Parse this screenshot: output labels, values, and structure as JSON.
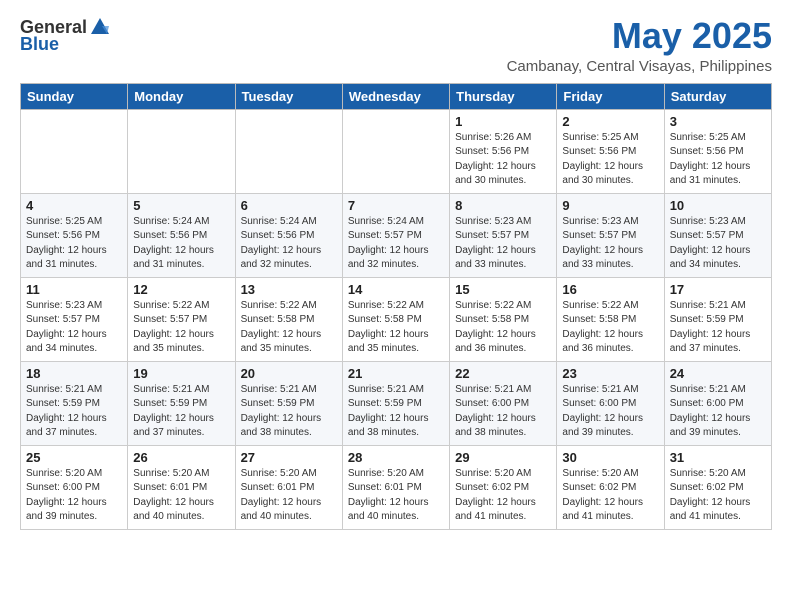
{
  "header": {
    "logo_general": "General",
    "logo_blue": "Blue",
    "month_title": "May 2025",
    "location": "Cambanay, Central Visayas, Philippines"
  },
  "weekdays": [
    "Sunday",
    "Monday",
    "Tuesday",
    "Wednesday",
    "Thursday",
    "Friday",
    "Saturday"
  ],
  "weeks": [
    [
      {
        "day": "",
        "info": ""
      },
      {
        "day": "",
        "info": ""
      },
      {
        "day": "",
        "info": ""
      },
      {
        "day": "",
        "info": ""
      },
      {
        "day": "1",
        "info": "Sunrise: 5:26 AM\nSunset: 5:56 PM\nDaylight: 12 hours\nand 30 minutes."
      },
      {
        "day": "2",
        "info": "Sunrise: 5:25 AM\nSunset: 5:56 PM\nDaylight: 12 hours\nand 30 minutes."
      },
      {
        "day": "3",
        "info": "Sunrise: 5:25 AM\nSunset: 5:56 PM\nDaylight: 12 hours\nand 31 minutes."
      }
    ],
    [
      {
        "day": "4",
        "info": "Sunrise: 5:25 AM\nSunset: 5:56 PM\nDaylight: 12 hours\nand 31 minutes."
      },
      {
        "day": "5",
        "info": "Sunrise: 5:24 AM\nSunset: 5:56 PM\nDaylight: 12 hours\nand 31 minutes."
      },
      {
        "day": "6",
        "info": "Sunrise: 5:24 AM\nSunset: 5:56 PM\nDaylight: 12 hours\nand 32 minutes."
      },
      {
        "day": "7",
        "info": "Sunrise: 5:24 AM\nSunset: 5:57 PM\nDaylight: 12 hours\nand 32 minutes."
      },
      {
        "day": "8",
        "info": "Sunrise: 5:23 AM\nSunset: 5:57 PM\nDaylight: 12 hours\nand 33 minutes."
      },
      {
        "day": "9",
        "info": "Sunrise: 5:23 AM\nSunset: 5:57 PM\nDaylight: 12 hours\nand 33 minutes."
      },
      {
        "day": "10",
        "info": "Sunrise: 5:23 AM\nSunset: 5:57 PM\nDaylight: 12 hours\nand 34 minutes."
      }
    ],
    [
      {
        "day": "11",
        "info": "Sunrise: 5:23 AM\nSunset: 5:57 PM\nDaylight: 12 hours\nand 34 minutes."
      },
      {
        "day": "12",
        "info": "Sunrise: 5:22 AM\nSunset: 5:57 PM\nDaylight: 12 hours\nand 35 minutes."
      },
      {
        "day": "13",
        "info": "Sunrise: 5:22 AM\nSunset: 5:58 PM\nDaylight: 12 hours\nand 35 minutes."
      },
      {
        "day": "14",
        "info": "Sunrise: 5:22 AM\nSunset: 5:58 PM\nDaylight: 12 hours\nand 35 minutes."
      },
      {
        "day": "15",
        "info": "Sunrise: 5:22 AM\nSunset: 5:58 PM\nDaylight: 12 hours\nand 36 minutes."
      },
      {
        "day": "16",
        "info": "Sunrise: 5:22 AM\nSunset: 5:58 PM\nDaylight: 12 hours\nand 36 minutes."
      },
      {
        "day": "17",
        "info": "Sunrise: 5:21 AM\nSunset: 5:59 PM\nDaylight: 12 hours\nand 37 minutes."
      }
    ],
    [
      {
        "day": "18",
        "info": "Sunrise: 5:21 AM\nSunset: 5:59 PM\nDaylight: 12 hours\nand 37 minutes."
      },
      {
        "day": "19",
        "info": "Sunrise: 5:21 AM\nSunset: 5:59 PM\nDaylight: 12 hours\nand 37 minutes."
      },
      {
        "day": "20",
        "info": "Sunrise: 5:21 AM\nSunset: 5:59 PM\nDaylight: 12 hours\nand 38 minutes."
      },
      {
        "day": "21",
        "info": "Sunrise: 5:21 AM\nSunset: 5:59 PM\nDaylight: 12 hours\nand 38 minutes."
      },
      {
        "day": "22",
        "info": "Sunrise: 5:21 AM\nSunset: 6:00 PM\nDaylight: 12 hours\nand 38 minutes."
      },
      {
        "day": "23",
        "info": "Sunrise: 5:21 AM\nSunset: 6:00 PM\nDaylight: 12 hours\nand 39 minutes."
      },
      {
        "day": "24",
        "info": "Sunrise: 5:21 AM\nSunset: 6:00 PM\nDaylight: 12 hours\nand 39 minutes."
      }
    ],
    [
      {
        "day": "25",
        "info": "Sunrise: 5:20 AM\nSunset: 6:00 PM\nDaylight: 12 hours\nand 39 minutes."
      },
      {
        "day": "26",
        "info": "Sunrise: 5:20 AM\nSunset: 6:01 PM\nDaylight: 12 hours\nand 40 minutes."
      },
      {
        "day": "27",
        "info": "Sunrise: 5:20 AM\nSunset: 6:01 PM\nDaylight: 12 hours\nand 40 minutes."
      },
      {
        "day": "28",
        "info": "Sunrise: 5:20 AM\nSunset: 6:01 PM\nDaylight: 12 hours\nand 40 minutes."
      },
      {
        "day": "29",
        "info": "Sunrise: 5:20 AM\nSunset: 6:02 PM\nDaylight: 12 hours\nand 41 minutes."
      },
      {
        "day": "30",
        "info": "Sunrise: 5:20 AM\nSunset: 6:02 PM\nDaylight: 12 hours\nand 41 minutes."
      },
      {
        "day": "31",
        "info": "Sunrise: 5:20 AM\nSunset: 6:02 PM\nDaylight: 12 hours\nand 41 minutes."
      }
    ]
  ]
}
